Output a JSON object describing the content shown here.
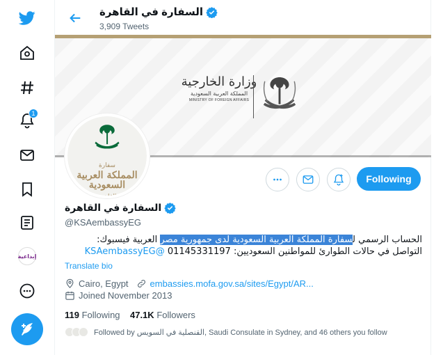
{
  "nav": {
    "items": [
      {
        "name": "home-nav-button",
        "icon": "home-icon"
      },
      {
        "name": "explore-nav-button",
        "icon": "hashtag-icon"
      },
      {
        "name": "notifications-nav-button",
        "icon": "bell-icon",
        "badge": "1"
      },
      {
        "name": "messages-nav-button",
        "icon": "mail-icon"
      },
      {
        "name": "bookmarks-nav-button",
        "icon": "bookmark-icon"
      },
      {
        "name": "lists-nav-button",
        "icon": "list-icon"
      }
    ],
    "avatar_text": "إبداعية",
    "more_icon": "more-circle-icon",
    "compose_icon": "compose-tweet-icon"
  },
  "header": {
    "title": "السفارة في القاهرة",
    "tweet_count": "3,909 Tweets"
  },
  "banner": {
    "ministry_ar": "وزارة الخارجية",
    "kingdom_ar": "المملكة العربية السعودية",
    "ministry_en": "MINISTRY OF FOREIGN AFFAIRS"
  },
  "avatar": {
    "line1": "سفارة",
    "line2": "المملكة العربية السعودية",
    "line3": "القاهرة"
  },
  "actions": {
    "following_label": "Following"
  },
  "profile": {
    "name": "السفارة في القاهرة",
    "handle": "@KSAembassyEG",
    "bio_line1_pre": "الحساب الرسمي ل",
    "bio_line1_highlight": "سفارة المملكة العربية السعودية لدى جمهورية مصر",
    "bio_line1_post": " العربية فيسبوك:",
    "bio_line2_link": "@KSAembassyEG",
    "bio_line2_text": " التواصل في حالات الطوارئ للمواطنين السعوديين: 01145331197",
    "translate": "Translate bio",
    "location": "Cairo, Egypt",
    "website": "embassies.mofa.gov.sa/sites/Egypt/AR...",
    "joined": "Joined November 2013",
    "following_count": "119",
    "following_label": "Following",
    "followers_count": "47.1K",
    "followers_label": "Followers",
    "followed_by": "Followed by القنصلية في السويس, Saudi Consulate in Sydney, and 46 others you follow"
  },
  "colors": {
    "accent": "#1d9bf0",
    "banner_gold": "#b5a074",
    "secondary_text": "#536471"
  }
}
